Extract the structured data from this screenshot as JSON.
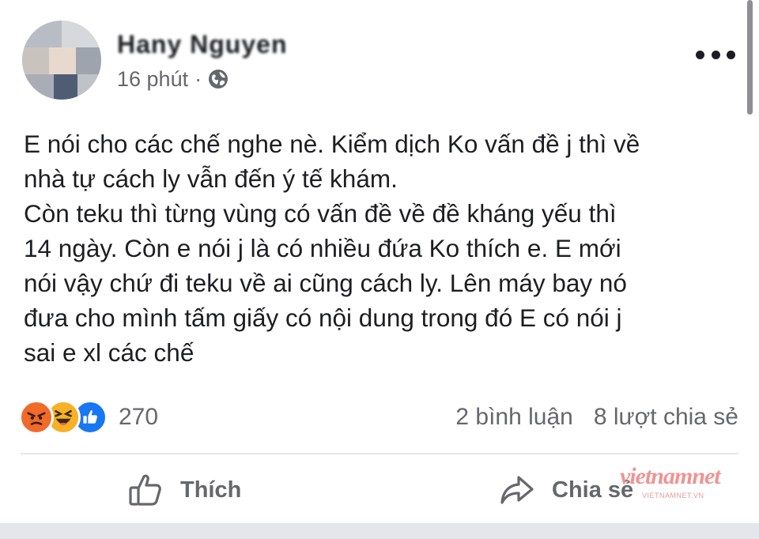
{
  "post": {
    "author_name": "Hany Nguyen",
    "timestamp": "16 phút",
    "separator": "·",
    "privacy_icon": "globe-icon",
    "more_icon": "more-horizontal-icon",
    "text": "E nói cho các chế nghe nè. Kiểm dịch Ko vấn đề j thì về\nnhà tự cách ly vẫn đến ý tế khám.\nCòn teku thì từng vùng có vấn đề về đề kháng yếu thì\n14 ngày. Còn e nói j là có nhiều đứa Ko thích e. E mới\nnói vậy chứ đi teku về ai cũng cách ly. Lên máy bay nó\nđưa cho mình tấm giấy có nội dung trong đó E có nói j\nsai e xl các chế"
  },
  "reactions": {
    "icons": [
      "angry-reaction-icon",
      "haha-reaction-icon",
      "like-reaction-icon"
    ],
    "count": "270"
  },
  "stats": {
    "comments": "2 bình luận",
    "shares": "8 lượt chia sẻ"
  },
  "actions": {
    "like_label": "Thích",
    "share_label": "Chia sẻ"
  },
  "watermark": {
    "text": "vietnamnet",
    "sub": "VIETNAMNET.VN"
  },
  "colors": {
    "text_primary": "#1c1e21",
    "text_secondary": "#65676b",
    "angry": "#f06a2a",
    "haha": "#f7b125",
    "like": "#1877f2",
    "divider": "#e4e6eb"
  }
}
